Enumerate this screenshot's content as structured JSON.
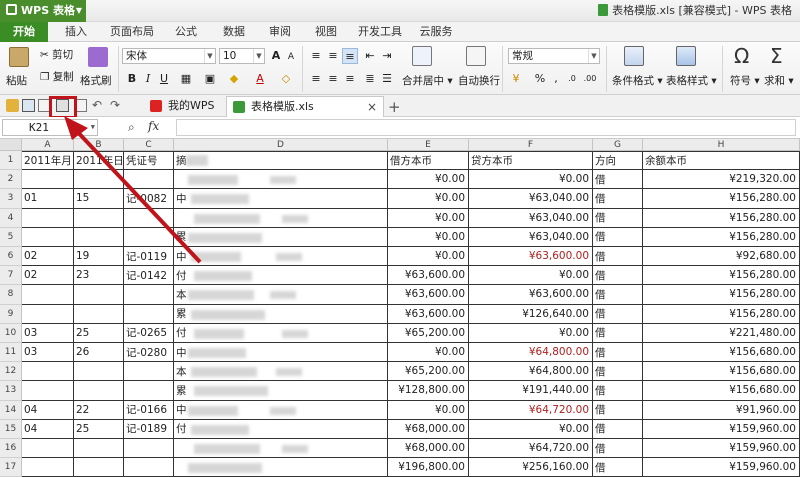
{
  "window": {
    "app_name": "WPS 表格",
    "title": "表格模版.xls [兼容模式] - WPS 表格"
  },
  "ribbon_tabs": [
    "开始",
    "插入",
    "页面布局",
    "公式",
    "数据",
    "审阅",
    "视图",
    "开发工具",
    "云服务"
  ],
  "ribbon": {
    "paste": "粘贴",
    "cut": "剪切",
    "copy": "复制",
    "format_painter": "格式刷",
    "font_name": "宋体",
    "font_size": "10",
    "merge_center": "合并居中",
    "wrap_text": "自动换行",
    "number_format": "常规",
    "conditional_format": "条件格式",
    "table_style": "表格样式",
    "symbol": "符号",
    "sum": "求和"
  },
  "doc_tabs": [
    {
      "label": "我的WPS"
    },
    {
      "label": "表格模版.xls"
    }
  ],
  "formula_bar": {
    "name_box": "K21",
    "fx": "fx"
  },
  "columns": [
    "A",
    "B",
    "C",
    "D",
    "E",
    "F",
    "G",
    "H"
  ],
  "rows": [
    "1",
    "2",
    "3",
    "4",
    "5",
    "6",
    "7",
    "8",
    "9",
    "10",
    "11",
    "12",
    "13",
    "14",
    "15",
    "16",
    "17"
  ],
  "table": {
    "header": [
      "2011年月",
      "2011年日",
      "凭证号",
      "摘",
      "",
      "借方本币",
      "贷方本币",
      "方向",
      "余额本币"
    ],
    "data": [
      [
        "",
        "",
        "",
        "",
        "¥0.00",
        "¥0.00",
        "借",
        "¥219,320.00",
        false
      ],
      [
        "01",
        "15",
        "记-0082",
        "中",
        "¥0.00",
        "¥63,040.00",
        "借",
        "¥156,280.00",
        false
      ],
      [
        "",
        "",
        "",
        "",
        "¥0.00",
        "¥63,040.00",
        "借",
        "¥156,280.00",
        false
      ],
      [
        "",
        "",
        "",
        "累",
        "¥0.00",
        "¥63,040.00",
        "借",
        "¥156,280.00",
        false
      ],
      [
        "02",
        "19",
        "记-0119",
        "中",
        "¥0.00",
        "¥63,600.00",
        "借",
        "¥92,680.00",
        true
      ],
      [
        "02",
        "23",
        "记-0142",
        "付",
        "¥63,600.00",
        "¥0.00",
        "借",
        "¥156,280.00",
        false
      ],
      [
        "",
        "",
        "",
        "本",
        "¥63,600.00",
        "¥63,600.00",
        "借",
        "¥156,280.00",
        false
      ],
      [
        "",
        "",
        "",
        "累",
        "¥63,600.00",
        "¥126,640.00",
        "借",
        "¥156,280.00",
        false
      ],
      [
        "03",
        "25",
        "记-0265",
        "付",
        "¥65,200.00",
        "¥0.00",
        "借",
        "¥221,480.00",
        false
      ],
      [
        "03",
        "26",
        "记-0280",
        "中",
        "¥0.00",
        "¥64,800.00",
        "借",
        "¥156,680.00",
        true
      ],
      [
        "",
        "",
        "",
        "本",
        "¥65,200.00",
        "¥64,800.00",
        "借",
        "¥156,680.00",
        false
      ],
      [
        "",
        "",
        "",
        "累",
        "¥128,800.00",
        "¥191,440.00",
        "借",
        "¥156,680.00",
        false
      ],
      [
        "04",
        "22",
        "记-0166",
        "中",
        "¥0.00",
        "¥64,720.00",
        "借",
        "¥91,960.00",
        true
      ],
      [
        "04",
        "25",
        "记-0189",
        "付",
        "¥68,000.00",
        "¥0.00",
        "借",
        "¥159,960.00",
        false
      ],
      [
        "",
        "",
        "",
        "",
        "¥68,000.00",
        "¥64,720.00",
        "借",
        "¥159,960.00",
        false
      ],
      [
        "",
        "",
        "",
        "",
        "¥196,800.00",
        "¥256,160.00",
        "借",
        "¥159,960.00",
        false
      ]
    ]
  },
  "colors": {
    "accent_green": "#3a8d24",
    "annotation_red": "#c0141a",
    "negative_red": "#b02020"
  }
}
